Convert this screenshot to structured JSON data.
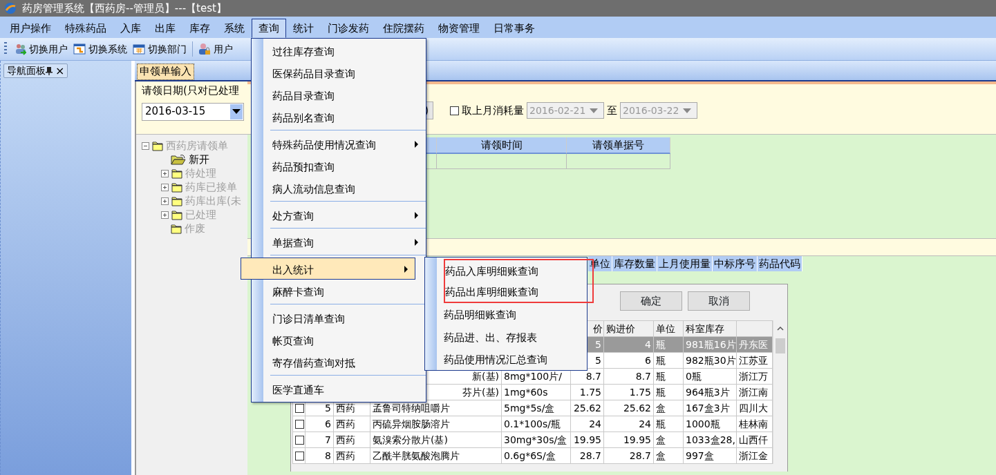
{
  "window": {
    "title": "药房管理系统【西药房--管理员】---【test】"
  },
  "menubar": [
    {
      "label": "用户操作",
      "selected": false
    },
    {
      "label": "特殊药品",
      "selected": false
    },
    {
      "label": "入库",
      "selected": false
    },
    {
      "label": "出库",
      "selected": false
    },
    {
      "label": "库存",
      "selected": false
    },
    {
      "label": "系统",
      "selected": false
    },
    {
      "label": "查询",
      "selected": true
    },
    {
      "label": "统计",
      "selected": false
    },
    {
      "label": "门诊发药",
      "selected": false
    },
    {
      "label": "住院摆药",
      "selected": false
    },
    {
      "label": "物资管理",
      "selected": false
    },
    {
      "label": "日常事务",
      "selected": false
    }
  ],
  "toolbar": [
    {
      "kind": "users",
      "label": "切换用户"
    },
    {
      "kind": "window",
      "label": "切换系统"
    },
    {
      "kind": "calendar",
      "label": "切换部门"
    },
    {
      "kind": "separator"
    },
    {
      "kind": "lock-user",
      "label": "用户"
    }
  ],
  "nav_panel": {
    "title": "导航面板",
    "close": "×"
  },
  "tabs": [
    {
      "label": "申领单输入",
      "selected": true
    }
  ],
  "date_group": {
    "label": "请领日期(只对已处理",
    "value": "2016-03-15"
  },
  "tree": [
    {
      "label": "西药房请领单",
      "kind": "folder",
      "disabled": true,
      "expanded": true,
      "children": [
        {
          "label": "新开",
          "kind": "open-folder",
          "disabled": false
        },
        {
          "label": "待处理",
          "kind": "folder",
          "disabled": true,
          "expanded": false
        },
        {
          "label": "药库已接单",
          "kind": "folder",
          "disabled": true,
          "expanded": false
        },
        {
          "label": "药库出库(未",
          "kind": "folder",
          "disabled": true,
          "expanded": false
        },
        {
          "label": "已处理",
          "kind": "folder",
          "disabled": true,
          "expanded": false
        },
        {
          "label": "作废",
          "kind": "folder",
          "disabled": true
        }
      ]
    }
  ],
  "filter": {
    "button_tail": ")",
    "checkbox": {
      "label": "取上月消耗量",
      "checked": false
    },
    "from": {
      "value": "2016-02-21",
      "disabled": true
    },
    "to_label": "至",
    "to": {
      "value": "2016-03-22",
      "disabled": true
    }
  },
  "request_grid": {
    "columns": [
      "请领时间",
      "请领单据号"
    ]
  },
  "detail_columns": [
    "单位",
    "库存数量",
    "上月使用量",
    "中标序号",
    "药品代码"
  ],
  "drug_picker": {
    "buttons": [
      "确定",
      "取消"
    ],
    "columns": {
      "price": "价",
      "cost": "购进价",
      "unit": "单位",
      "stock": "科室库存"
    },
    "rows": [
      {
        "selected": true,
        "price": "5",
        "cost": "4",
        "unit": "瓶",
        "stock": "981瓶16片",
        "maker": "丹东医"
      },
      {
        "selected": false,
        "price": "5",
        "cost": "6",
        "unit": "瓶",
        "stock": "982瓶30片",
        "maker": "江苏亚"
      },
      {
        "selected": false,
        "name_tail": "新(基)",
        "spec": "8mg*100片/",
        "price": "8.7",
        "cost": "8.7",
        "unit": "瓶",
        "stock": "0瓶",
        "maker": "浙江万"
      },
      {
        "selected": false,
        "name_tail": "芬片(基)",
        "spec": "1mg*60s",
        "price": "1.75",
        "cost": "1.75",
        "unit": "瓶",
        "stock": "964瓶3片",
        "maker": "浙江南"
      },
      {
        "selected": false,
        "checked": false,
        "no": "5",
        "type": "西药",
        "name": "孟鲁司特纳咀嚼片",
        "spec": "5mg*5s/盒",
        "price": "25.62",
        "cost": "25.62",
        "unit": "盒",
        "stock": "167盒3片",
        "maker": "四川大"
      },
      {
        "selected": false,
        "checked": false,
        "no": "6",
        "type": "西药",
        "name": "丙硫异烟胺肠溶片",
        "spec": "0.1*100s/瓶",
        "price": "24",
        "cost": "24",
        "unit": "瓶",
        "stock": "1000瓶",
        "maker": "桂林南"
      },
      {
        "selected": false,
        "checked": false,
        "no": "7",
        "type": "西药",
        "name": "氨溴索分散片(基)",
        "spec": "30mg*30s/盒",
        "price": "19.95",
        "cost": "19.95",
        "unit": "盒",
        "stock": "1033盒28,",
        "maker": "山西仟"
      },
      {
        "selected": false,
        "checked": false,
        "no": "8",
        "type": "西药",
        "name": "乙酰半胱氨酸泡腾片",
        "spec": "0.6g*6S/盒",
        "price": "28.7",
        "cost": "28.7",
        "unit": "盒",
        "stock": "997盒",
        "maker": "浙江金"
      }
    ]
  },
  "menu": {
    "items": [
      {
        "kind": "item",
        "label": "过往库存查询",
        "submenu": false,
        "selected": false
      },
      {
        "kind": "item",
        "label": "医保药品目录查询",
        "submenu": false,
        "selected": false
      },
      {
        "kind": "item",
        "label": "药品目录查询",
        "submenu": false,
        "selected": false
      },
      {
        "kind": "item",
        "label": "药品别名查询",
        "submenu": false,
        "selected": false
      },
      {
        "kind": "separator"
      },
      {
        "kind": "item",
        "label": "特殊药品使用情况查询",
        "submenu": true,
        "selected": false
      },
      {
        "kind": "item",
        "label": "药品预扣查询",
        "submenu": false,
        "selected": false
      },
      {
        "kind": "item",
        "label": "病人流动信息查询",
        "submenu": false,
        "selected": false
      },
      {
        "kind": "separator"
      },
      {
        "kind": "item",
        "label": "处方查询",
        "submenu": true,
        "selected": false
      },
      {
        "kind": "separator"
      },
      {
        "kind": "item",
        "label": "单据查询",
        "submenu": true,
        "selected": false
      },
      {
        "kind": "separator"
      },
      {
        "kind": "item",
        "label": "出入统计",
        "submenu": true,
        "selected": true
      },
      {
        "kind": "item",
        "label": "麻醉卡查询",
        "submenu": false,
        "selected": false
      },
      {
        "kind": "separator"
      },
      {
        "kind": "item",
        "label": "门诊日清单查询",
        "submenu": false,
        "selected": false
      },
      {
        "kind": "item",
        "label": "帐页查询",
        "submenu": false,
        "selected": false
      },
      {
        "kind": "item",
        "label": "寄存借药查询对抵",
        "submenu": false,
        "selected": false
      },
      {
        "kind": "separator"
      },
      {
        "kind": "item",
        "label": "医学直通车",
        "submenu": false,
        "selected": false
      }
    ]
  },
  "submenu": {
    "items": [
      {
        "label": "药品入库明细账查询",
        "marked": true
      },
      {
        "label": "药品出库明细账查询",
        "marked": true
      },
      {
        "label": "药品明细账查询",
        "marked": false
      },
      {
        "label": "药品进、出、存报表",
        "marked": false
      },
      {
        "label": "药品使用情况汇总查询",
        "marked": false
      }
    ]
  }
}
